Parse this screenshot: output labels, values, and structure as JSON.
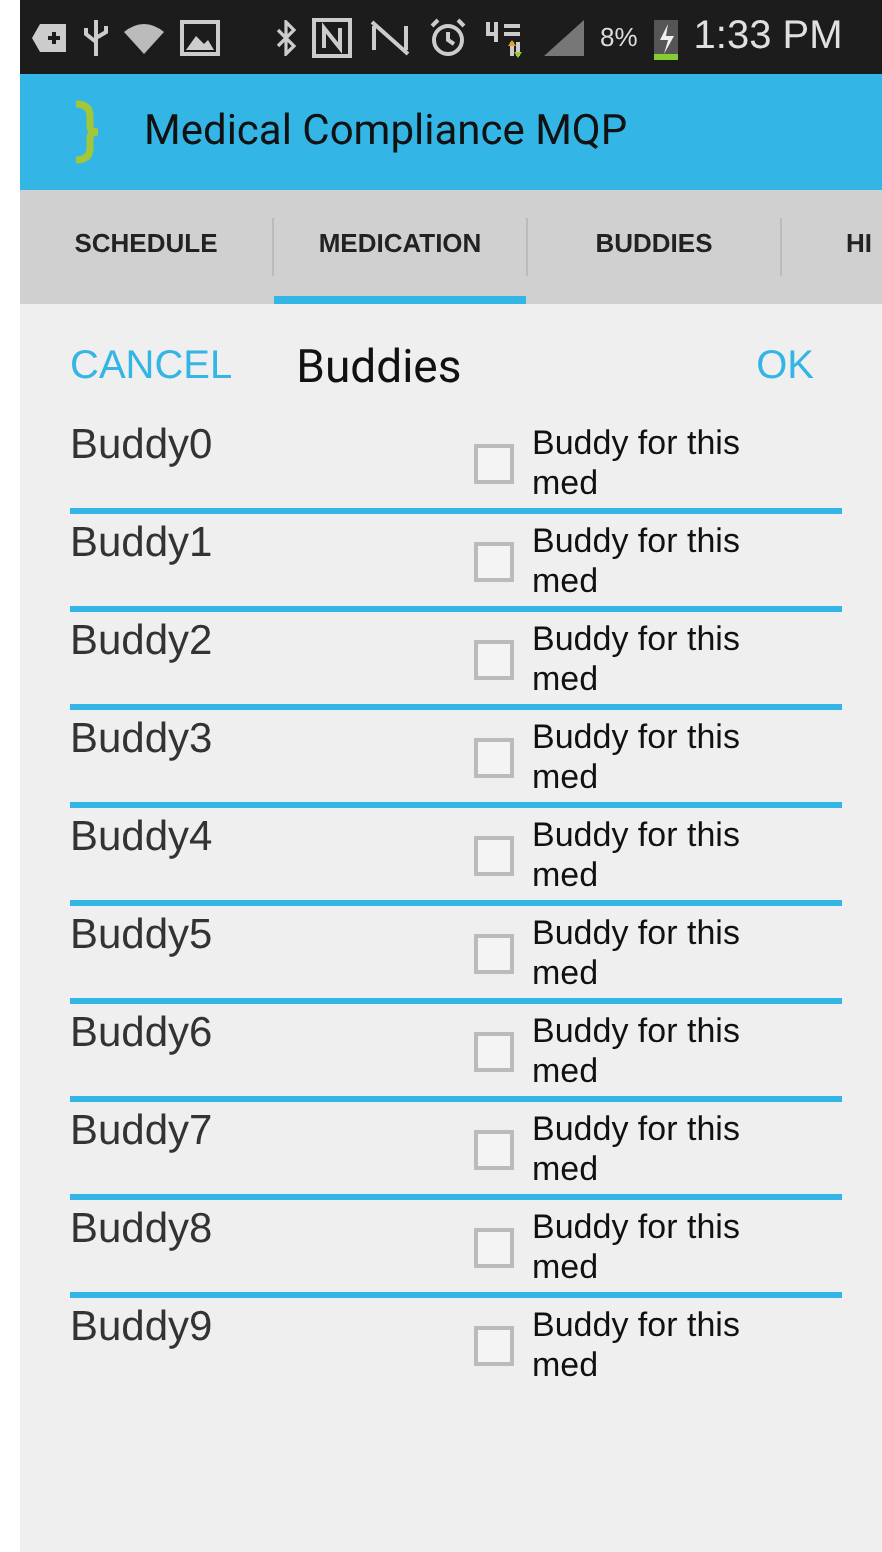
{
  "status_bar": {
    "battery": "8%",
    "time": "1:33 PM"
  },
  "app_bar": {
    "title": "Medical Compliance MQP"
  },
  "tabs": [
    {
      "label": "SCHEDULE",
      "selected": false
    },
    {
      "label": "MEDICATION",
      "selected": true
    },
    {
      "label": "BUDDIES",
      "selected": false
    },
    {
      "label": "HI",
      "selected": false
    }
  ],
  "dialog": {
    "cancel": "CANCEL",
    "title": "Buddies",
    "ok": "OK",
    "rows": [
      {
        "name": "Buddy0",
        "label": "Buddy for this med",
        "checked": false
      },
      {
        "name": "Buddy1",
        "label": "Buddy for this med",
        "checked": false
      },
      {
        "name": "Buddy2",
        "label": "Buddy for this med",
        "checked": false
      },
      {
        "name": "Buddy3",
        "label": "Buddy for this med",
        "checked": false
      },
      {
        "name": "Buddy4",
        "label": "Buddy for this med",
        "checked": false
      },
      {
        "name": "Buddy5",
        "label": "Buddy for this med",
        "checked": false
      },
      {
        "name": "Buddy6",
        "label": "Buddy for this med",
        "checked": false
      },
      {
        "name": "Buddy7",
        "label": "Buddy for this med",
        "checked": false
      },
      {
        "name": "Buddy8",
        "label": "Buddy for this med",
        "checked": false
      },
      {
        "name": "Buddy9",
        "label": "Buddy for this med",
        "checked": false
      }
    ]
  }
}
